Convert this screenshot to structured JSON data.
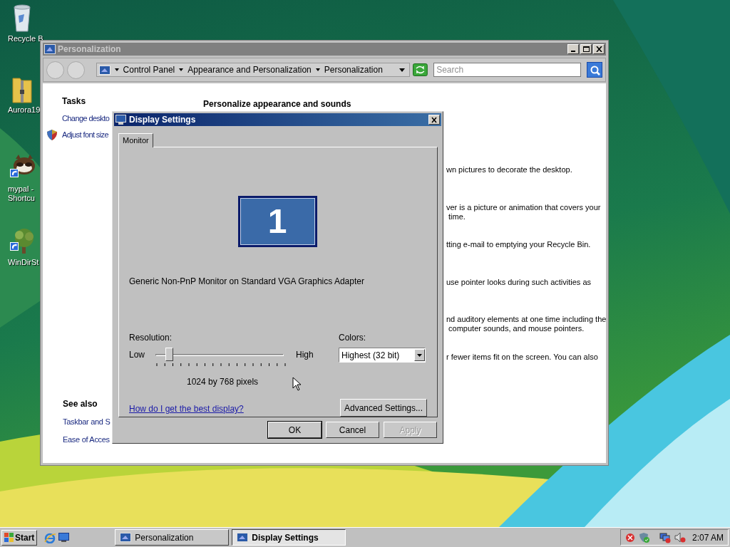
{
  "desktop_icons": [
    {
      "kind": "recycle",
      "lines": [
        "Recycle B"
      ]
    },
    {
      "kind": "zip",
      "lines": [
        "Aurora19"
      ]
    },
    {
      "kind": "animal",
      "lines": [
        "mypal -",
        "Shortcu"
      ]
    },
    {
      "kind": "tree",
      "lines": [
        "WinDirSt"
      ]
    }
  ],
  "explorer_window": {
    "title": "Personalization",
    "active": false,
    "breadcrumb": [
      "Control Panel",
      "Appearance and Personalization",
      "Personalization"
    ],
    "search": {
      "placeholder": "Search"
    },
    "tasks_heading": "Tasks",
    "tasks": [
      {
        "label": "Change deskto",
        "shield": false
      },
      {
        "label": "Adjust font size",
        "shield": true
      }
    ],
    "heading": "Personalize appearance and sounds",
    "descriptions": [
      {
        "lines": [
          "wn pictures to decorate the desktop."
        ]
      },
      {
        "lines": [
          "ver is a picture or animation that covers your",
          " time."
        ]
      },
      {
        "lines": [
          "tting e-mail to emptying your Recycle Bin."
        ]
      },
      {
        "lines": [
          "use pointer looks during such activities as"
        ]
      },
      {
        "lines": [
          "nd auditory elements at one time including the",
          " computer sounds, and mouse pointers."
        ]
      },
      {
        "lines": [
          "r fewer items fit on the screen. You can also"
        ]
      }
    ],
    "see_also_heading": "See also",
    "see_also": [
      "Taskbar and S",
      "Ease of Acces"
    ]
  },
  "dialog": {
    "title": "Display Settings",
    "tabs": [
      {
        "label": "Monitor",
        "selected": true
      }
    ],
    "monitor_number": "1",
    "monitor_name": "Generic Non-PnP Monitor on Standard VGA Graphics Adapter",
    "resolution_label": "Resolution:",
    "low": "Low",
    "high": "High",
    "level": 0.0625,
    "resolution_text": "1024 by 768 pixels",
    "colors_label": "Colors:",
    "colors_value": "Highest (32 bit)",
    "help_link": "How do I get the best display?",
    "advanced_button": "Advanced Settings...",
    "buttons": [
      {
        "label": "OK",
        "disabled": false,
        "default": true
      },
      {
        "label": "Cancel",
        "disabled": false,
        "default": false
      },
      {
        "label": "Apply",
        "disabled": true,
        "default": false
      }
    ]
  },
  "taskbar": {
    "start": "Start",
    "tasks": [
      {
        "label": "Personalization",
        "selected": false
      },
      {
        "label": "Display Settings",
        "selected": true
      }
    ],
    "clock": "2:07 AM"
  }
}
